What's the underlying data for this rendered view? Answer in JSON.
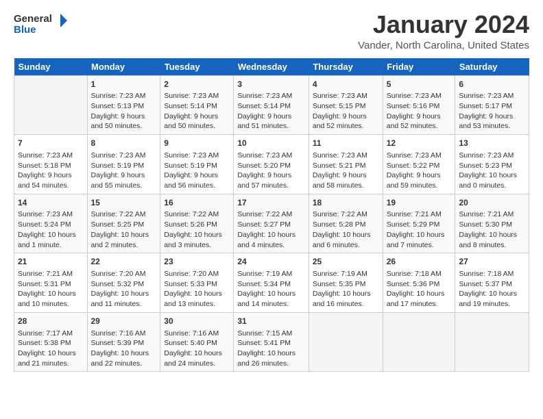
{
  "logo": {
    "line1": "General",
    "line2": "Blue"
  },
  "title": "January 2024",
  "location": "Vander, North Carolina, United States",
  "weekdays": [
    "Sunday",
    "Monday",
    "Tuesday",
    "Wednesday",
    "Thursday",
    "Friday",
    "Saturday"
  ],
  "weeks": [
    [
      {
        "day": "",
        "info": ""
      },
      {
        "day": "1",
        "info": "Sunrise: 7:23 AM\nSunset: 5:13 PM\nDaylight: 9 hours\nand 50 minutes."
      },
      {
        "day": "2",
        "info": "Sunrise: 7:23 AM\nSunset: 5:14 PM\nDaylight: 9 hours\nand 50 minutes."
      },
      {
        "day": "3",
        "info": "Sunrise: 7:23 AM\nSunset: 5:14 PM\nDaylight: 9 hours\nand 51 minutes."
      },
      {
        "day": "4",
        "info": "Sunrise: 7:23 AM\nSunset: 5:15 PM\nDaylight: 9 hours\nand 52 minutes."
      },
      {
        "day": "5",
        "info": "Sunrise: 7:23 AM\nSunset: 5:16 PM\nDaylight: 9 hours\nand 52 minutes."
      },
      {
        "day": "6",
        "info": "Sunrise: 7:23 AM\nSunset: 5:17 PM\nDaylight: 9 hours\nand 53 minutes."
      }
    ],
    [
      {
        "day": "7",
        "info": "Sunrise: 7:23 AM\nSunset: 5:18 PM\nDaylight: 9 hours\nand 54 minutes."
      },
      {
        "day": "8",
        "info": "Sunrise: 7:23 AM\nSunset: 5:19 PM\nDaylight: 9 hours\nand 55 minutes."
      },
      {
        "day": "9",
        "info": "Sunrise: 7:23 AM\nSunset: 5:19 PM\nDaylight: 9 hours\nand 56 minutes."
      },
      {
        "day": "10",
        "info": "Sunrise: 7:23 AM\nSunset: 5:20 PM\nDaylight: 9 hours\nand 57 minutes."
      },
      {
        "day": "11",
        "info": "Sunrise: 7:23 AM\nSunset: 5:21 PM\nDaylight: 9 hours\nand 58 minutes."
      },
      {
        "day": "12",
        "info": "Sunrise: 7:23 AM\nSunset: 5:22 PM\nDaylight: 9 hours\nand 59 minutes."
      },
      {
        "day": "13",
        "info": "Sunrise: 7:23 AM\nSunset: 5:23 PM\nDaylight: 10 hours\nand 0 minutes."
      }
    ],
    [
      {
        "day": "14",
        "info": "Sunrise: 7:23 AM\nSunset: 5:24 PM\nDaylight: 10 hours\nand 1 minute."
      },
      {
        "day": "15",
        "info": "Sunrise: 7:22 AM\nSunset: 5:25 PM\nDaylight: 10 hours\nand 2 minutes."
      },
      {
        "day": "16",
        "info": "Sunrise: 7:22 AM\nSunset: 5:26 PM\nDaylight: 10 hours\nand 3 minutes."
      },
      {
        "day": "17",
        "info": "Sunrise: 7:22 AM\nSunset: 5:27 PM\nDaylight: 10 hours\nand 4 minutes."
      },
      {
        "day": "18",
        "info": "Sunrise: 7:22 AM\nSunset: 5:28 PM\nDaylight: 10 hours\nand 6 minutes."
      },
      {
        "day": "19",
        "info": "Sunrise: 7:21 AM\nSunset: 5:29 PM\nDaylight: 10 hours\nand 7 minutes."
      },
      {
        "day": "20",
        "info": "Sunrise: 7:21 AM\nSunset: 5:30 PM\nDaylight: 10 hours\nand 8 minutes."
      }
    ],
    [
      {
        "day": "21",
        "info": "Sunrise: 7:21 AM\nSunset: 5:31 PM\nDaylight: 10 hours\nand 10 minutes."
      },
      {
        "day": "22",
        "info": "Sunrise: 7:20 AM\nSunset: 5:32 PM\nDaylight: 10 hours\nand 11 minutes."
      },
      {
        "day": "23",
        "info": "Sunrise: 7:20 AM\nSunset: 5:33 PM\nDaylight: 10 hours\nand 13 minutes."
      },
      {
        "day": "24",
        "info": "Sunrise: 7:19 AM\nSunset: 5:34 PM\nDaylight: 10 hours\nand 14 minutes."
      },
      {
        "day": "25",
        "info": "Sunrise: 7:19 AM\nSunset: 5:35 PM\nDaylight: 10 hours\nand 16 minutes."
      },
      {
        "day": "26",
        "info": "Sunrise: 7:18 AM\nSunset: 5:36 PM\nDaylight: 10 hours\nand 17 minutes."
      },
      {
        "day": "27",
        "info": "Sunrise: 7:18 AM\nSunset: 5:37 PM\nDaylight: 10 hours\nand 19 minutes."
      }
    ],
    [
      {
        "day": "28",
        "info": "Sunrise: 7:17 AM\nSunset: 5:38 PM\nDaylight: 10 hours\nand 21 minutes."
      },
      {
        "day": "29",
        "info": "Sunrise: 7:16 AM\nSunset: 5:39 PM\nDaylight: 10 hours\nand 22 minutes."
      },
      {
        "day": "30",
        "info": "Sunrise: 7:16 AM\nSunset: 5:40 PM\nDaylight: 10 hours\nand 24 minutes."
      },
      {
        "day": "31",
        "info": "Sunrise: 7:15 AM\nSunset: 5:41 PM\nDaylight: 10 hours\nand 26 minutes."
      },
      {
        "day": "",
        "info": ""
      },
      {
        "day": "",
        "info": ""
      },
      {
        "day": "",
        "info": ""
      }
    ]
  ]
}
